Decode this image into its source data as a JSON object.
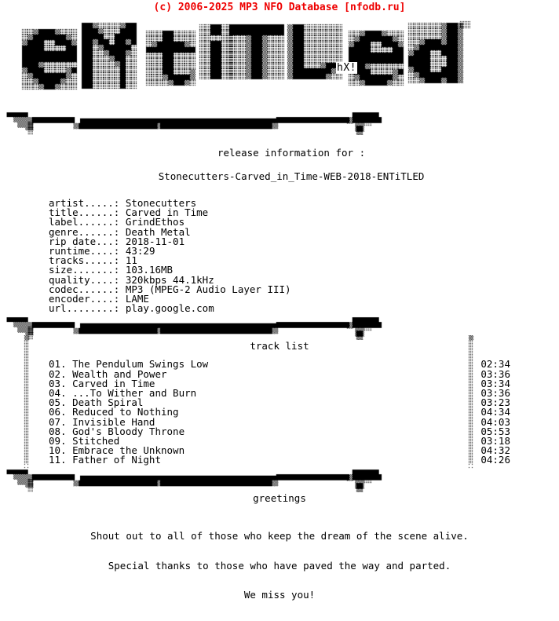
{
  "header": {
    "copyright": "(c) 2006-2025 MP3 NFO Database [nfodb.ru]",
    "copyright_color": "#ee0000"
  },
  "logo": {
    "text": "eNtiTLed",
    "group_tag": "hX!",
    "style": "ascii-block-art"
  },
  "release_section": {
    "title_line1": "release information for :",
    "title_line2": "Stonecutters-Carved_in_Time-WEB-2018-ENTiTLED",
    "fields": [
      {
        "key": "artist.....:",
        "value": "Stonecutters"
      },
      {
        "key": "title......:",
        "value": "Carved in Time"
      },
      {
        "key": "label......:",
        "value": "GrindEthos"
      },
      {
        "key": "genre......:",
        "value": "Death Metal"
      },
      {
        "key": "rip date...:",
        "value": "2018-11-01"
      },
      {
        "key": "runtime....:",
        "value": "43:29"
      },
      {
        "key": "tracks.....:",
        "value": "11"
      },
      {
        "key": "size.......:",
        "value": "103.16MB"
      },
      {
        "key": "quality....:",
        "value": "320kbps 44.1kHz"
      },
      {
        "key": "codec......:",
        "value": "MP3 (MPEG-2 Audio Layer III)"
      },
      {
        "key": "encoder....:",
        "value": "LAME"
      },
      {
        "key": "url........:",
        "value": "play.google.com"
      }
    ]
  },
  "track_section": {
    "title": "track list",
    "tracks": [
      {
        "num": "01.",
        "name": "The Pendulum Swings Low",
        "time": "02:34"
      },
      {
        "num": "02.",
        "name": "Wealth and Power",
        "time": "03:36"
      },
      {
        "num": "03.",
        "name": "Carved in Time",
        "time": "03:34"
      },
      {
        "num": "04.",
        "name": "...To Wither and Burn",
        "time": "03:36"
      },
      {
        "num": "05.",
        "name": "Death Spiral",
        "time": "03:23"
      },
      {
        "num": "06.",
        "name": "Reduced to Nothing",
        "time": "04:34"
      },
      {
        "num": "07.",
        "name": "Invisible Hand",
        "time": "04:03"
      },
      {
        "num": "08.",
        "name": "God's Bloody Throne",
        "time": "05:53"
      },
      {
        "num": "09.",
        "name": "Stitched",
        "time": "03:18"
      },
      {
        "num": "10.",
        "name": "Embrace the Unknown",
        "time": "04:32"
      },
      {
        "num": "11.",
        "name": "Father of Night",
        "time": "04:26"
      }
    ]
  },
  "greetings_section": {
    "title": "greetings",
    "line1": "Shout out to all of those who keep the dream of the scene alive.",
    "line2": "Special thanks to those who have paved the way and parted.",
    "line3": "We miss you!"
  },
  "colors": {
    "background": "#ffffff",
    "text": "#000000",
    "accent_red": "#ee0000"
  }
}
